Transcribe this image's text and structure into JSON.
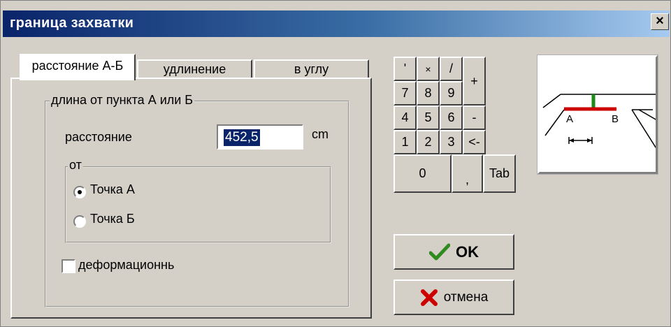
{
  "window": {
    "title": "граница захватки",
    "close_glyph": "×"
  },
  "tabs": [
    {
      "label": "расстояние А-Б",
      "active": true
    },
    {
      "label": "удлинение",
      "active": false
    },
    {
      "label": "в углу",
      "active": false
    }
  ],
  "length_group": {
    "legend": "длина от пункта А или Б",
    "distance_label": "расстояние",
    "distance_value": "452,5",
    "unit": "cm"
  },
  "from_group": {
    "legend": "от",
    "options": [
      {
        "label": "Точка А",
        "selected": true
      },
      {
        "label": "Точка Б",
        "selected": false
      }
    ]
  },
  "deformation": {
    "label": "деформационнь",
    "checked": false
  },
  "keypad": {
    "keys": [
      "'",
      "×",
      "/",
      "+",
      "7",
      "8",
      "9",
      "4",
      "5",
      "6",
      "-",
      "1",
      "2",
      "3",
      "<-",
      "0",
      ",",
      "Tab"
    ]
  },
  "buttons": {
    "ok_label": "OK",
    "cancel_label": "отмена"
  },
  "preview": {
    "label_a": "A",
    "label_b": "B"
  },
  "colors": {
    "accent_red": "#cc0000",
    "accent_green": "#008000",
    "title_start": "#0a246a",
    "title_end": "#a6caf0"
  }
}
